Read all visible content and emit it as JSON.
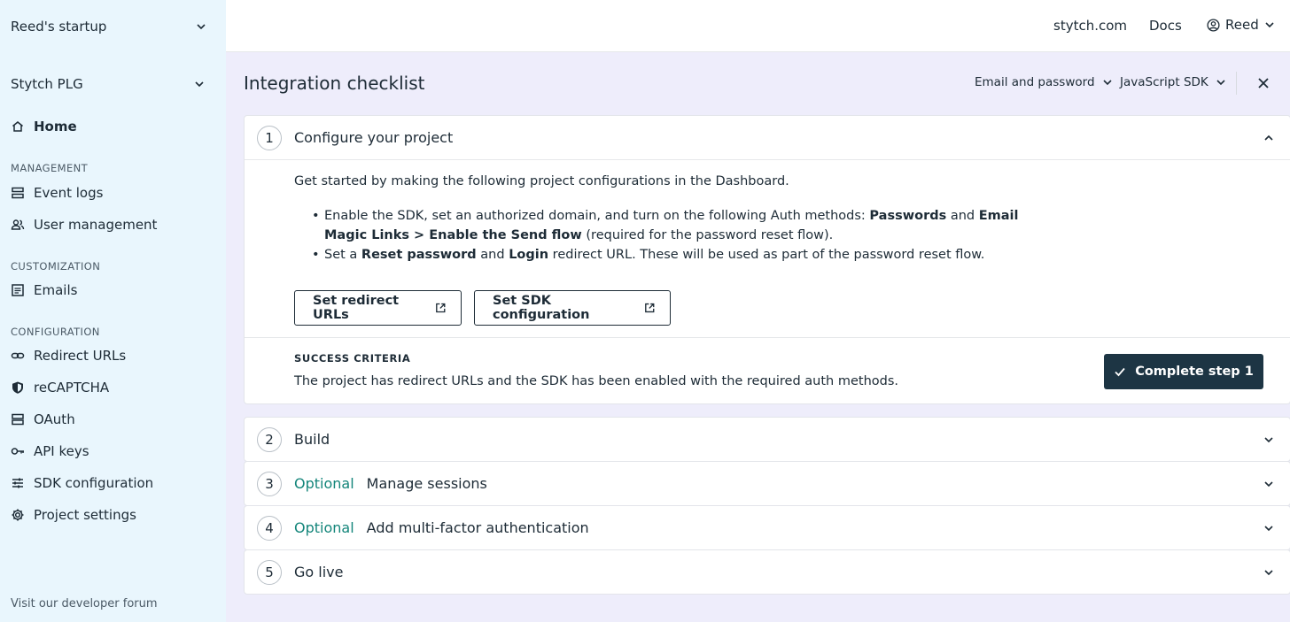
{
  "sidebar": {
    "org_name": "Reed's startup",
    "project_name": "Stytch PLG",
    "home_label": "Home",
    "sections": {
      "management": "MANAGEMENT",
      "customization": "CUSTOMIZATION",
      "configuration": "CONFIGURATION"
    },
    "items": {
      "event_logs": "Event logs",
      "user_management": "User management",
      "emails": "Emails",
      "redirect_urls": "Redirect URLs",
      "recaptcha": "reCAPTCHA",
      "oauth": "OAuth",
      "api_keys": "API keys",
      "sdk_configuration": "SDK configuration",
      "project_settings": "Project settings"
    },
    "forum_link": "Visit our developer forum"
  },
  "header": {
    "site_link": "stytch.com",
    "docs_link": "Docs",
    "user_name": "Reed"
  },
  "main": {
    "title": "Integration checklist",
    "filter_auth": "Email and password",
    "filter_sdk": "JavaScript SDK",
    "steps": [
      {
        "number": "1",
        "title": "Configure your project",
        "intro": "Get started by making the following project configurations in the Dashboard.",
        "bullet1_a": "Enable the SDK, set an authorized domain, and turn on the following Auth methods: ",
        "bullet1_b": "Passwords",
        "bullet1_c": " and ",
        "bullet1_d": "Email Magic Links > Enable the Send flow",
        "bullet1_e": " (required for the password reset flow).",
        "bullet2_a": "Set a ",
        "bullet2_b": "Reset password",
        "bullet2_c": " and ",
        "bullet2_d": "Login",
        "bullet2_e": " redirect URL. These will be used as part of the password reset flow.",
        "button_redirect": "Set redirect URLs",
        "button_sdk": "Set SDK configuration",
        "criteria_label": "SUCCESS CRITERIA",
        "criteria_text": "The project has redirect URLs and the SDK has been enabled with the required auth methods.",
        "complete_button": "Complete step 1"
      },
      {
        "number": "2",
        "optional": "",
        "title": "Build"
      },
      {
        "number": "3",
        "optional": "Optional",
        "title": "Manage sessions"
      },
      {
        "number": "4",
        "optional": "Optional",
        "title": "Add multi-factor authentication"
      },
      {
        "number": "5",
        "optional": "",
        "title": "Go live"
      }
    ]
  },
  "colors": {
    "sidebar_bg": "#e9f6fd",
    "main_bg": "#eeedfb",
    "primary_button": "#1d3544",
    "optional_text": "#13857a"
  }
}
